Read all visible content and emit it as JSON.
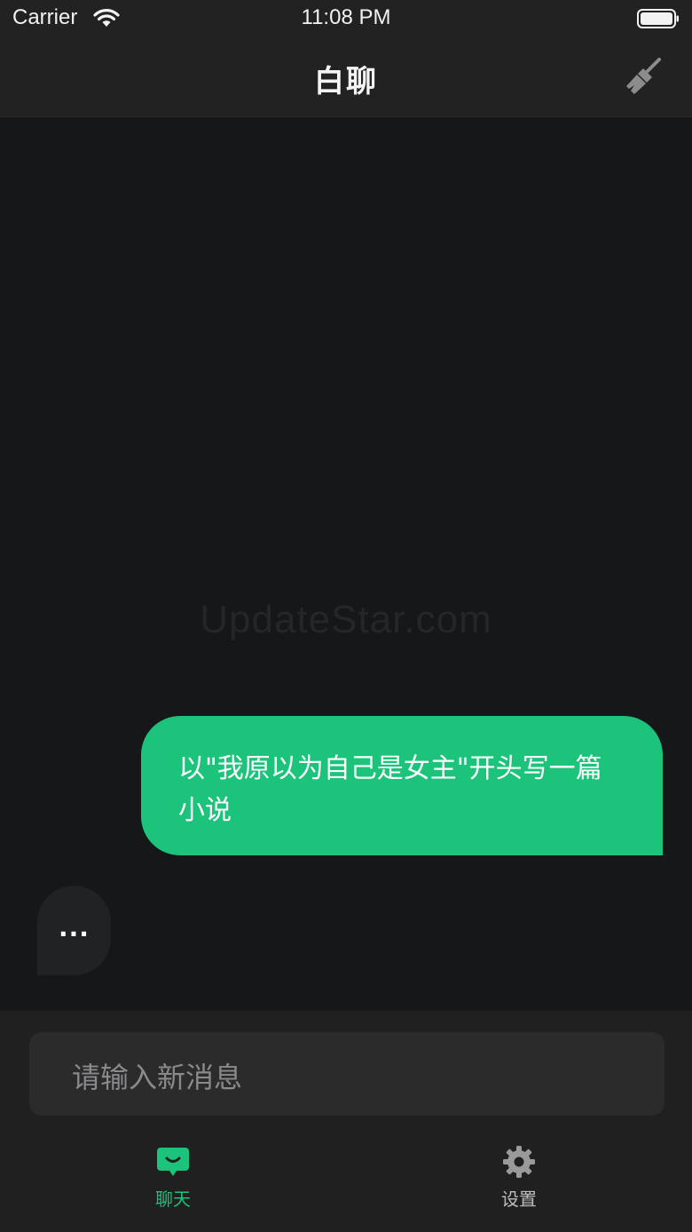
{
  "status_bar": {
    "carrier": "Carrier",
    "time": "11:08 PM"
  },
  "nav": {
    "title": "白聊",
    "clear_icon": "broom-icon"
  },
  "chat": {
    "watermark": "UpdateStar.com",
    "user_message": "以\"我原以为自己是女主\"开头写一篇小说",
    "bot_typing": "..."
  },
  "input": {
    "placeholder": "请输入新消息"
  },
  "tabs": [
    {
      "label": "聊天",
      "icon": "chat-bubble-icon",
      "active": true
    },
    {
      "label": "设置",
      "icon": "gear-icon",
      "active": false
    }
  ],
  "colors": {
    "accent": "#1cc37a",
    "background": "#161718",
    "bar": "#222222"
  }
}
